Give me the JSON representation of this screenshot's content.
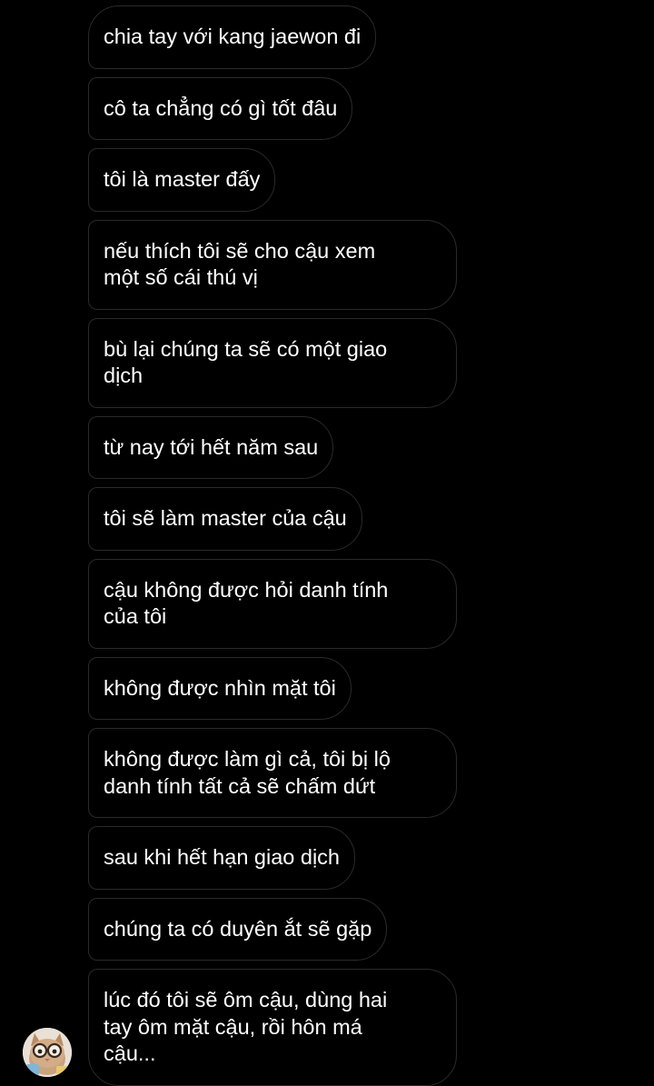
{
  "conversation": {
    "messages": [
      "chia tay với kang jaewon đi",
      "cô ta chẳng có gì tốt đâu",
      "tôi là master đấy",
      "nếu thích tôi sẽ cho cậu xem\nmột số cái thú vị",
      "bù lại chúng ta sẽ có một giao\ndịch",
      "từ nay tới hết năm sau",
      "tôi sẽ làm master của cậu",
      "cậu không được hỏi danh tính\ncủa tôi",
      "không được nhìn mặt tôi",
      "không được làm gì cả, tôi bị lộ\ndanh tính tất cả sẽ chấm dứt",
      "sau khi hết hạn giao dịch",
      "chúng ta có duyên ắt sẽ gặp",
      "lúc đó tôi sẽ ôm cậu, dùng hai\ntay ôm mặt cậu, rồi hôn má\ncậu..."
    ]
  },
  "sender": {
    "avatar_icon": "cat-with-glasses-avatar"
  },
  "colors": {
    "background": "#000000",
    "bubble_border": "#2a2a2a",
    "text": "#ffffff"
  }
}
